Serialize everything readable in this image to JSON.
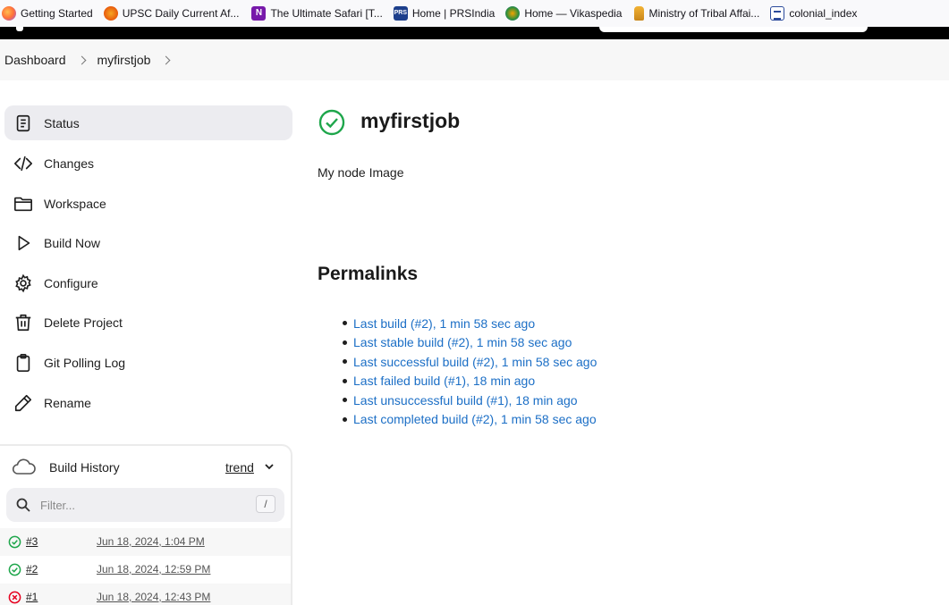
{
  "bookmarks": [
    {
      "label": "Getting Started",
      "icon": "firefox-icon"
    },
    {
      "label": "UPSC Daily Current Af...",
      "icon": "upsc-icon"
    },
    {
      "label": "The Ultimate Safari [T...",
      "icon": "onenote-icon"
    },
    {
      "label": "Home | PRSIndia",
      "icon": "prs-icon"
    },
    {
      "label": "Home — Vikaspedia",
      "icon": "vikaspedia-icon"
    },
    {
      "label": "Ministry of Tribal Affai...",
      "icon": "emblem-icon"
    },
    {
      "label": "colonial_index",
      "icon": "crown-icon"
    }
  ],
  "breadcrumb": {
    "items": [
      "Dashboard",
      "myfirstjob"
    ]
  },
  "sidebar": {
    "items": [
      {
        "label": "Status",
        "icon": "notepad-icon",
        "active": true
      },
      {
        "label": "Changes",
        "icon": "code-icon"
      },
      {
        "label": "Workspace",
        "icon": "folder-icon"
      },
      {
        "label": "Build Now",
        "icon": "play-icon"
      },
      {
        "label": "Configure",
        "icon": "gear-icon"
      },
      {
        "label": "Delete Project",
        "icon": "trash-icon"
      },
      {
        "label": "Git Polling Log",
        "icon": "clipboard-icon"
      },
      {
        "label": "Rename",
        "icon": "pencil-icon"
      }
    ]
  },
  "build_history": {
    "title": "Build History",
    "trend_label": "trend",
    "filter_placeholder": "Filter...",
    "filter_shortcut": "/",
    "builds": [
      {
        "number": "#3",
        "date": "Jun 18, 2024, 1:04 PM",
        "status": "success"
      },
      {
        "number": "#2",
        "date": "Jun 18, 2024, 12:59 PM",
        "status": "success"
      },
      {
        "number": "#1",
        "date": "Jun 18, 2024, 12:43 PM",
        "status": "failed"
      }
    ]
  },
  "job": {
    "name": "myfirstjob",
    "description": "My node Image",
    "status": "success"
  },
  "permalinks": {
    "title": "Permalinks",
    "links": [
      "Last build (#2), 1 min 58 sec ago",
      "Last stable build (#2), 1 min 58 sec ago",
      "Last successful build (#2), 1 min 58 sec ago",
      "Last failed build (#1), 18 min ago",
      "Last unsuccessful build (#1), 18 min ago",
      "Last completed build (#2), 1 min 58 sec ago"
    ]
  },
  "colors": {
    "success": "#1ea64b",
    "failed": "#e6001f",
    "link": "#1c6fc6"
  }
}
